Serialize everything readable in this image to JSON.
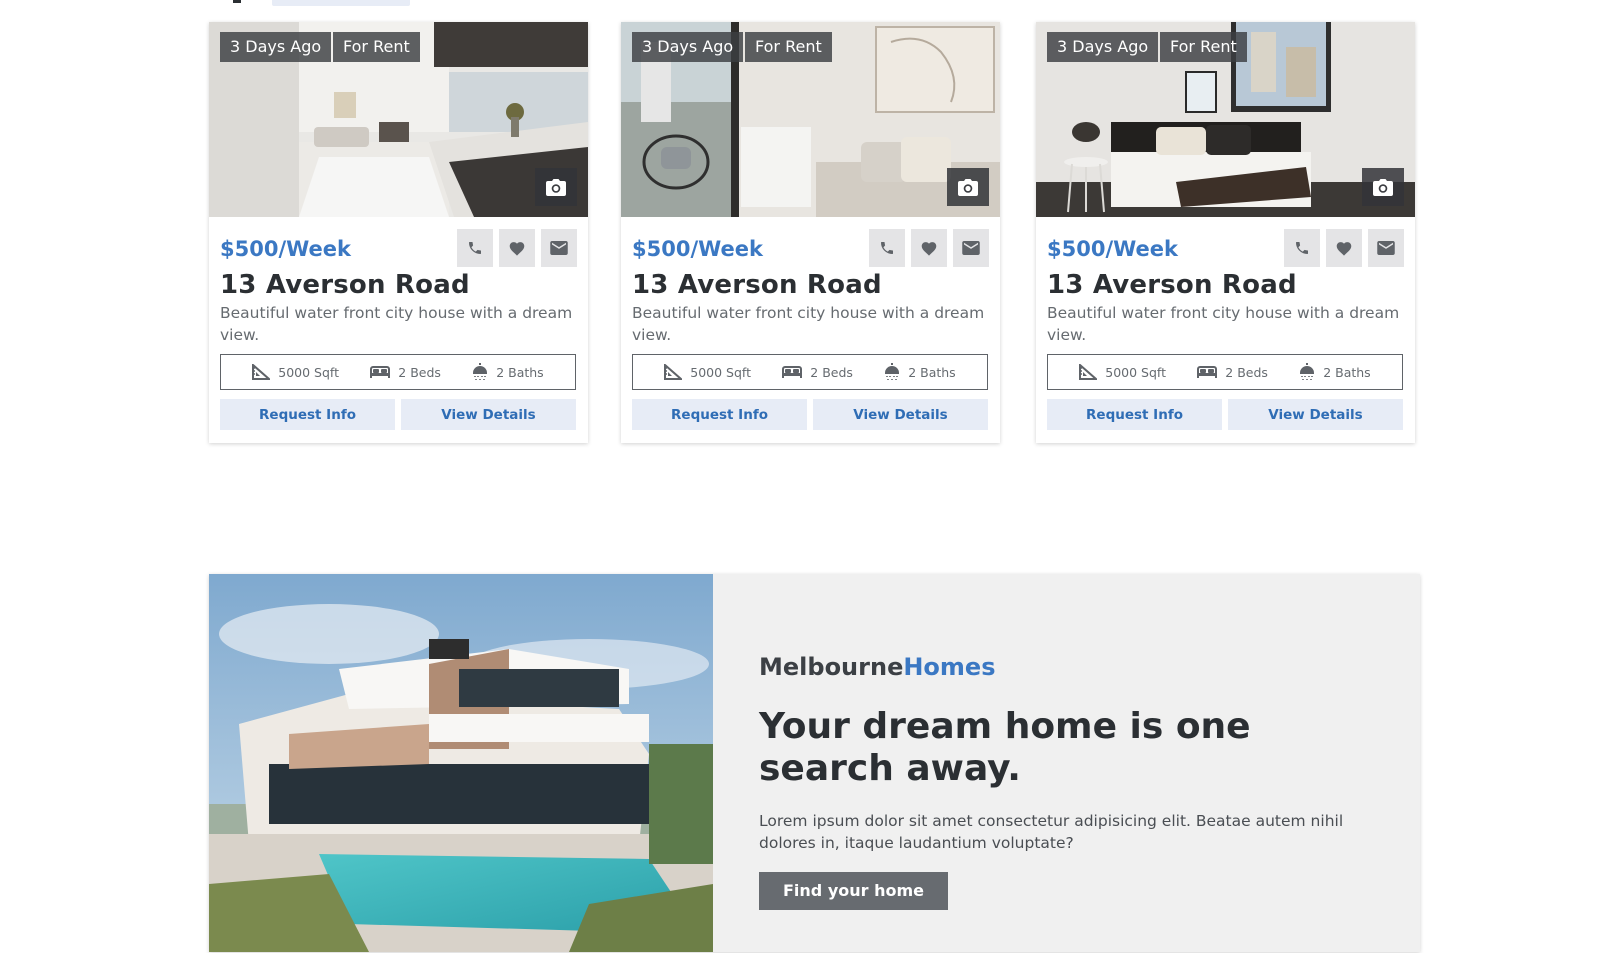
{
  "listings": [
    {
      "posted": "3 Days Ago",
      "status": "For Rent",
      "price": "$500/Week",
      "title": "13 Averson Road",
      "description": "Beautiful water front city house with a dream view.",
      "area": "5000 Sqft",
      "beds": "2 Beds",
      "baths": "2 Baths",
      "request_label": "Request Info",
      "details_label": "View Details"
    },
    {
      "posted": "3 Days Ago",
      "status": "For Rent",
      "price": "$500/Week",
      "title": "13 Averson Road",
      "description": "Beautiful water front city house with a dream view.",
      "area": "5000 Sqft",
      "beds": "2 Beds",
      "baths": "2 Baths",
      "request_label": "Request Info",
      "details_label": "View Details"
    },
    {
      "posted": "3 Days Ago",
      "status": "For Rent",
      "price": "$500/Week",
      "title": "13 Averson Road",
      "description": "Beautiful water front city house with a dream view.",
      "area": "5000 Sqft",
      "beds": "2 Beds",
      "baths": "2 Baths",
      "request_label": "Request Info",
      "details_label": "View Details"
    }
  ],
  "promo": {
    "brand_main": "Melbourne",
    "brand_highlight": "Homes",
    "headline": "Your dream home is one search away.",
    "text": "Lorem ipsum dolor sit amet consectetur adipisicing elit. Beatae autem nihil dolores in, itaque laudantium voluptate?",
    "cta_label": "Find your home"
  },
  "icons": {
    "camera": "camera-icon",
    "phone": "phone-icon",
    "favorite": "heart-icon",
    "email": "mail-icon",
    "area": "ruler-triangle-icon",
    "beds": "bed-icon",
    "baths": "shower-icon"
  },
  "colors": {
    "accent": "#3b78c3",
    "button_bg": "#e7ecf6",
    "cta_bg": "#676b70",
    "promo_bg": "#f0f0f0"
  }
}
